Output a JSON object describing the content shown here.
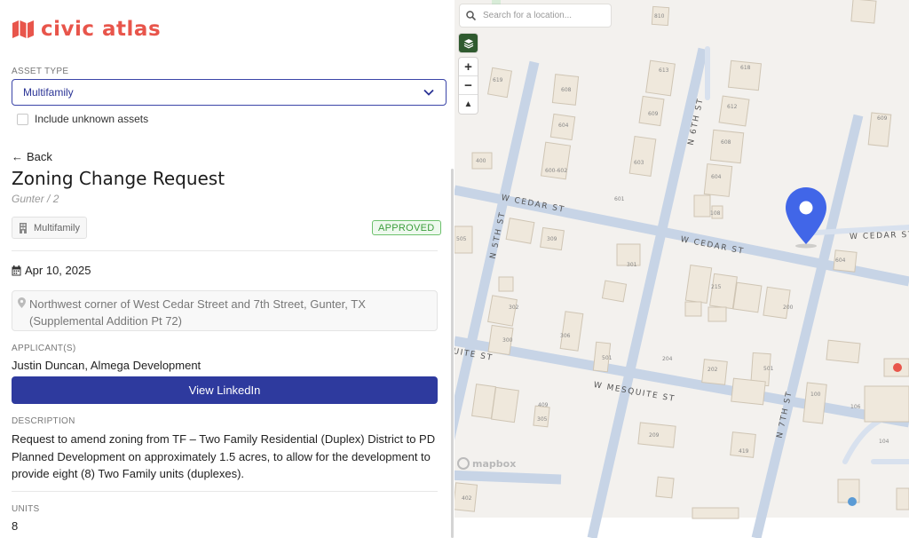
{
  "brand": {
    "name": "civic atlas",
    "color": "#e8554b"
  },
  "filter": {
    "asset_type_label": "ASSET TYPE",
    "asset_type_value": "Multifamily",
    "include_unknown_label": "Include unknown assets"
  },
  "detail": {
    "back_label": "Back",
    "title": "Zoning Change Request",
    "subtitle": "Gunter / 2",
    "asset_type": "Multifamily",
    "status": "APPROVED",
    "date": "Apr 10, 2025",
    "address": "Northwest corner of West Cedar Street and 7th Street, Gunter, TX (Supplemental Addition Pt 72)",
    "applicants_label": "APPLICANT(S)",
    "applicants": "Justin Duncan, Almega Development",
    "linkedin_button": "View LinkedIn",
    "description_label": "DESCRIPTION",
    "description": "Request to amend zoning from TF – Two Family Residential (Duplex) District to PD Planned Development on approximately 1.5 acres, to allow for the development to provide eight (8) Two Family units (duplexes).",
    "units_label": "UNITS",
    "units": "8"
  },
  "map": {
    "search_placeholder": "Search for a location...",
    "attribution": "mapbox",
    "zoom_in": "+",
    "zoom_out": "−",
    "compass": "▲",
    "pin_color": "#4166e8",
    "streets": {
      "cedar_left": "W CEDAR ST",
      "cedar_mid": "W CEDAR ST",
      "cedar_right": "W CEDAR ST",
      "n5th": "N 5TH ST",
      "n6th": "N 6TH ST",
      "n7th": "N 7TH ST",
      "mesquite": "W MESQUITE ST",
      "mesquite_left": "UITE ST"
    },
    "addresses": [
      "810",
      "613",
      "618",
      "619",
      "608",
      "609",
      "612",
      "604",
      "608",
      "609",
      "603",
      "600-602",
      "604",
      "400",
      "601",
      "108",
      "505",
      "309",
      "301",
      "604",
      "215",
      "200",
      "302",
      "300",
      "306",
      "501",
      "204",
      "202",
      "501",
      "100",
      "409",
      "305",
      "106",
      "209",
      "104",
      "419",
      "402"
    ]
  }
}
